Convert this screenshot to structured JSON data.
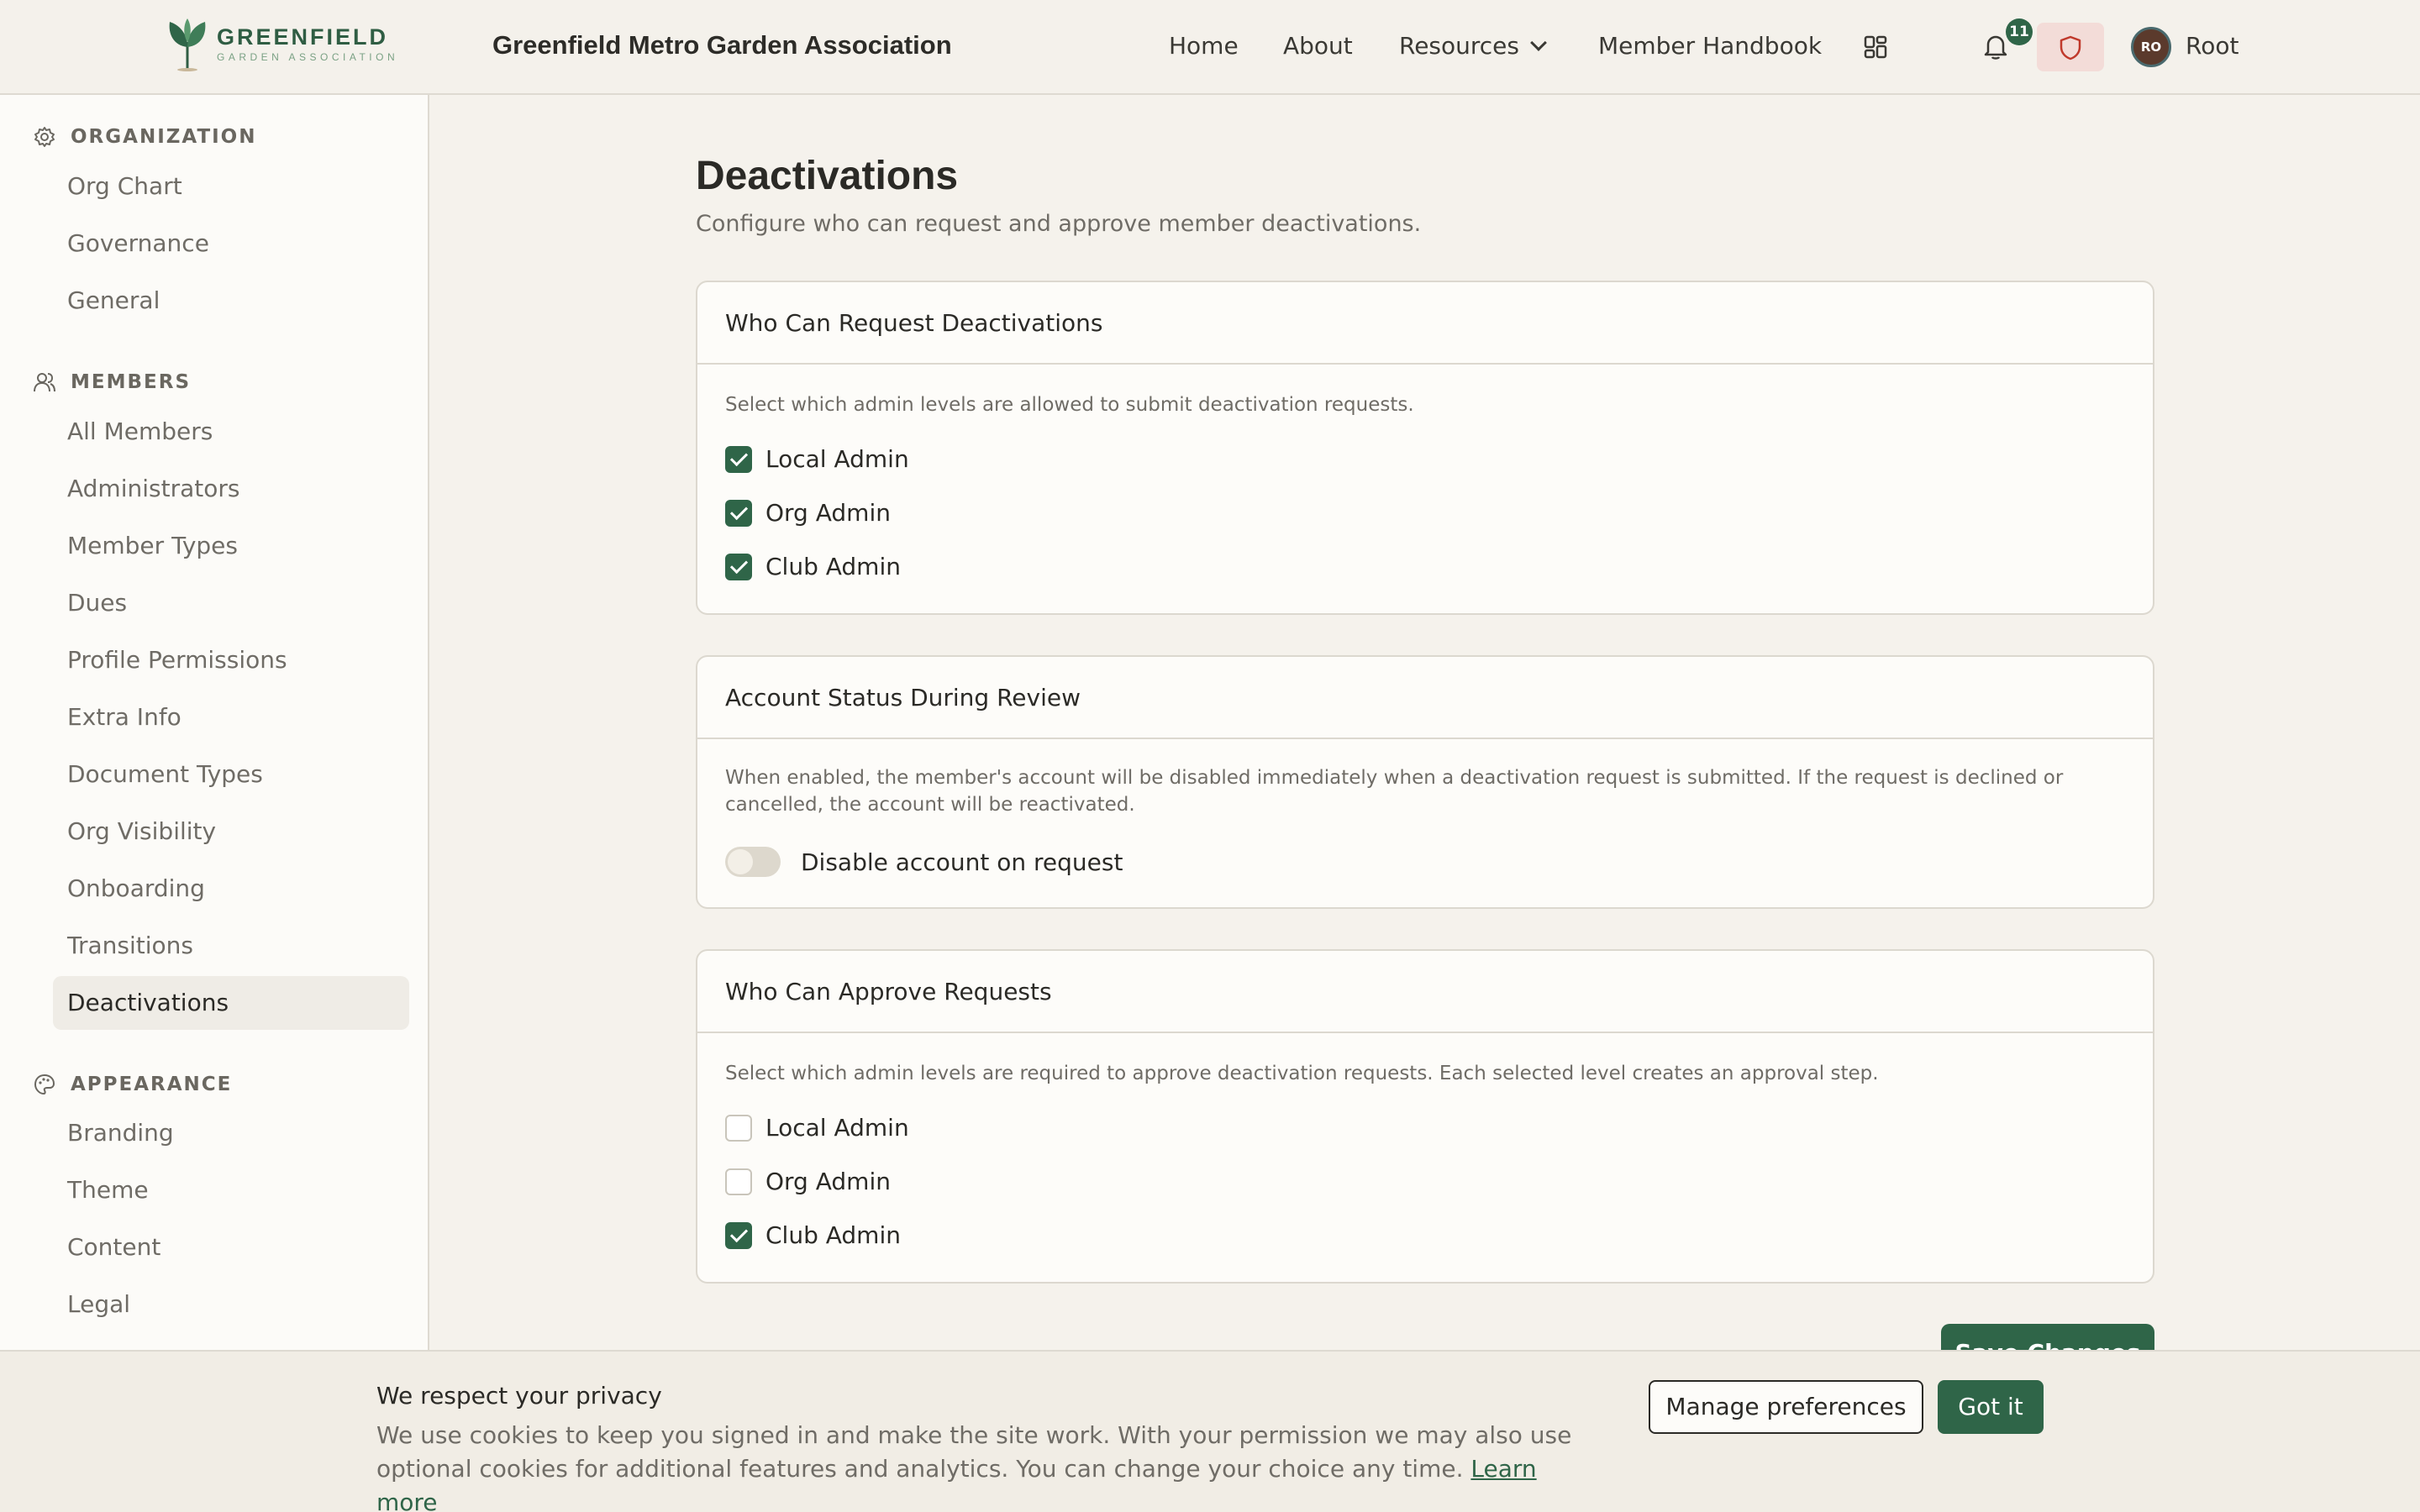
{
  "header": {
    "logo_name": "GREENFIELD",
    "logo_sub": "GARDEN ASSOCIATION",
    "org_title": "Greenfield Metro Garden Association",
    "nav": [
      "Home",
      "About",
      "Resources",
      "Member Handbook"
    ],
    "notification_count": "11",
    "avatar_initials": "RO",
    "user_name": "Root"
  },
  "sidebar": {
    "sections": [
      {
        "title": "ORGANIZATION",
        "icon": "gear-icon",
        "items": [
          "Org Chart",
          "Governance",
          "General"
        ]
      },
      {
        "title": "MEMBERS",
        "icon": "users-icon",
        "items": [
          "All Members",
          "Administrators",
          "Member Types",
          "Dues",
          "Profile Permissions",
          "Extra Info",
          "Document Types",
          "Org Visibility",
          "Onboarding",
          "Transitions",
          "Deactivations"
        ]
      },
      {
        "title": "APPEARANCE",
        "icon": "palette-icon",
        "items": [
          "Branding",
          "Theme",
          "Content",
          "Legal"
        ]
      }
    ],
    "active_item": "Deactivations"
  },
  "main": {
    "title": "Deactivations",
    "subtitle": "Configure who can request and approve member deactivations.",
    "request_card": {
      "title": "Who Can Request Deactivations",
      "description": "Select which admin levels are allowed to submit deactivation requests.",
      "options": [
        {
          "label": "Local Admin",
          "checked": true
        },
        {
          "label": "Org Admin",
          "checked": true
        },
        {
          "label": "Club Admin",
          "checked": true
        }
      ]
    },
    "status_card": {
      "title": "Account Status During Review",
      "description": "When enabled, the member's account will be disabled immediately when a deactivation request is submitted. If the request is declined or cancelled, the account will be reactivated.",
      "toggle_label": "Disable account on request",
      "toggle_on": false
    },
    "approve_card": {
      "title": "Who Can Approve Requests",
      "description": "Select which admin levels are required to approve deactivation requests. Each selected level creates an approval step.",
      "options": [
        {
          "label": "Local Admin",
          "checked": false
        },
        {
          "label": "Org Admin",
          "checked": false
        },
        {
          "label": "Club Admin",
          "checked": true
        }
      ]
    },
    "save_label": "Save Changes"
  },
  "cookie": {
    "title": "We respect your privacy",
    "text": "We use cookies to keep you signed in and make the site work. With your permission we may also use optional cookies for additional features and analytics. You can change your choice any time.",
    "link": "Learn more",
    "manage_label": "Manage preferences",
    "accept_label": "Got it"
  },
  "colors": {
    "accent": "#2f6548",
    "background": "#f5f2ec",
    "sidebar_bg": "#fcfbf8",
    "shield_bg": "#f3dcd8",
    "shield_icon": "#c0392b"
  }
}
